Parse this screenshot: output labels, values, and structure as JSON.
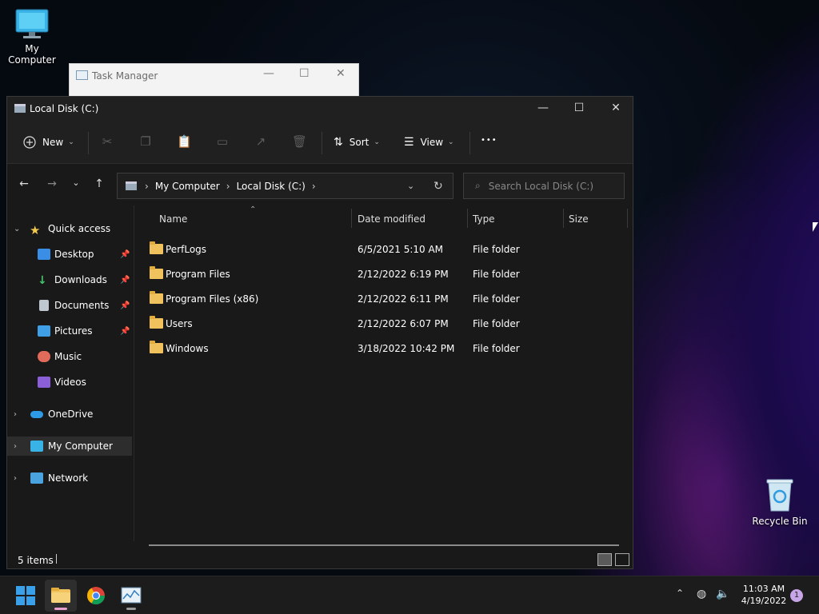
{
  "desktop": {
    "my_computer_label": "My Computer",
    "recycle_bin_label": "Recycle Bin"
  },
  "task_manager": {
    "title": "Task Manager",
    "minimize": "—",
    "maximize": "☐",
    "close": "✕"
  },
  "window": {
    "title": "Local Disk (C:)",
    "minimize": "—",
    "maximize": "☐",
    "close": "✕"
  },
  "toolbar": {
    "new_label": "New",
    "sort_label": "Sort",
    "view_label": "View",
    "more_label": "•••"
  },
  "address": {
    "crumbs": [
      "My Computer",
      "Local Disk (C:)"
    ],
    "search_placeholder": "Search Local Disk (C:)"
  },
  "sidebar": {
    "items": [
      {
        "label": "Quick access"
      },
      {
        "label": "Desktop"
      },
      {
        "label": "Downloads"
      },
      {
        "label": "Documents"
      },
      {
        "label": "Pictures"
      },
      {
        "label": "Music"
      },
      {
        "label": "Videos"
      },
      {
        "label": "OneDrive"
      },
      {
        "label": "My Computer"
      },
      {
        "label": "Network"
      }
    ]
  },
  "columns": {
    "name": "Name",
    "date": "Date modified",
    "type": "Type",
    "size": "Size"
  },
  "files": [
    {
      "name": "PerfLogs",
      "date": "6/5/2021 5:10 AM",
      "type": "File folder",
      "size": ""
    },
    {
      "name": "Program Files",
      "date": "2/12/2022 6:19 PM",
      "type": "File folder",
      "size": ""
    },
    {
      "name": "Program Files (x86)",
      "date": "2/12/2022 6:11 PM",
      "type": "File folder",
      "size": ""
    },
    {
      "name": "Users",
      "date": "2/12/2022 6:07 PM",
      "type": "File folder",
      "size": ""
    },
    {
      "name": "Windows",
      "date": "3/18/2022 10:42 PM",
      "type": "File folder",
      "size": ""
    }
  ],
  "status": {
    "items_count": "5 items"
  },
  "taskbar": {
    "time": "11:03 AM",
    "date": "4/19/2022",
    "notification_count": "1"
  },
  "colors": {
    "folder": "#f0c25e",
    "window_bg": "#191919",
    "chrome_bg": "#202020",
    "selected_bg": "#2d2d2d"
  }
}
